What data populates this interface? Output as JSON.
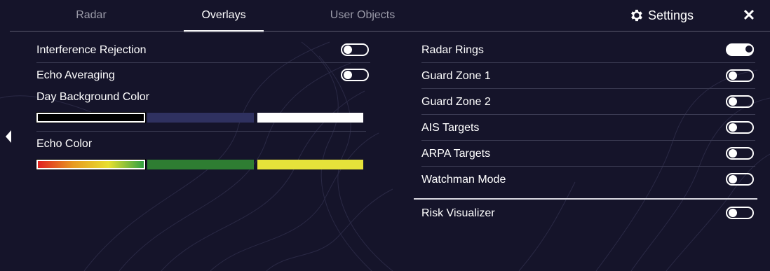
{
  "tabs": [
    {
      "label": "Radar",
      "active": false
    },
    {
      "label": "Overlays",
      "active": true
    },
    {
      "label": "User Objects",
      "active": false
    }
  ],
  "settings_label": "Settings",
  "close_label": "✕",
  "left": {
    "interference_rejection": {
      "label": "Interference Rejection",
      "on": false
    },
    "echo_averaging": {
      "label": "Echo Averaging",
      "on": false
    },
    "day_background": {
      "label": "Day Background Color",
      "swatches": [
        "#000000",
        "#2f3160",
        "#ffffff"
      ],
      "selected_index": 0
    },
    "echo_color": {
      "label": "Echo Color",
      "swatches": [
        "gradient-red-yellow-green",
        "#2e7d32",
        "#e6e23a"
      ],
      "selected_index": 0
    }
  },
  "right": {
    "items": [
      {
        "label": "Radar Rings",
        "on": true
      },
      {
        "label": "Guard Zone 1",
        "on": false
      },
      {
        "label": "Guard Zone 2",
        "on": false
      },
      {
        "label": "AIS Targets",
        "on": false
      },
      {
        "label": "ARPA Targets",
        "on": false
      },
      {
        "label": "Watchman Mode",
        "on": false
      }
    ],
    "risk_visualizer": {
      "label": "Risk Visualizer",
      "on": false
    }
  },
  "colors": {
    "background": "#15142a",
    "accent": "#ffffff",
    "divider": "#3a3a52"
  }
}
